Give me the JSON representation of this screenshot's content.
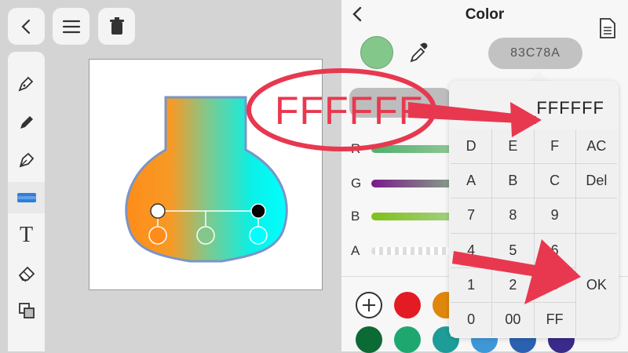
{
  "toolbar": {
    "back_icon": "chevron-left-icon",
    "menu_icon": "hamburger-menu-icon",
    "delete_icon": "trash-icon"
  },
  "tools": [
    "pen-icon",
    "pencil-icon",
    "fill-pen-icon",
    "gradient-tool-icon",
    "text-icon",
    "eraser-icon",
    "copy-icon"
  ],
  "tools_text": {
    "text_tool": "T"
  },
  "color_panel": {
    "title": "Color",
    "current_color": "#83C78A",
    "hex_value": "83C78A",
    "sliders": [
      {
        "label": "R"
      },
      {
        "label": "G"
      },
      {
        "label": "B"
      },
      {
        "label": "A"
      }
    ],
    "swatches_row1": [
      "add",
      "#e31b23",
      "#e0860a"
    ],
    "swatches_row2": [
      "#0c6a35",
      "#1ea870",
      "#1e9c98",
      "#3f97d8",
      "#2b62b0",
      "#3a2a8a"
    ]
  },
  "hex_popup": {
    "value": "FFFFFF",
    "keys": [
      "D",
      "E",
      "F",
      "AC",
      "A",
      "B",
      "C",
      "Del",
      "7",
      "8",
      "9",
      "4",
      "5",
      "6",
      "1",
      "2",
      "3",
      "0",
      "00",
      "FF"
    ],
    "ok_label": "OK"
  },
  "annotation": {
    "text": "FFFFFF",
    "color": "#e8384f"
  }
}
